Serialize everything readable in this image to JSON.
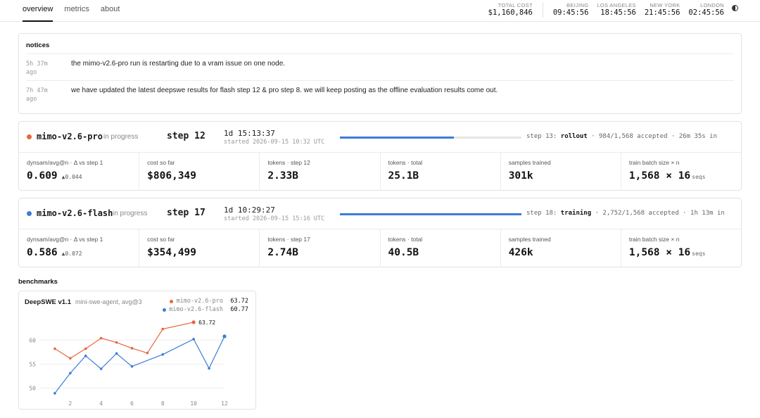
{
  "nav": {
    "tabs": [
      {
        "label": "overview",
        "active": true
      },
      {
        "label": "metrics",
        "active": false
      },
      {
        "label": "about",
        "active": false
      }
    ]
  },
  "header_stats": {
    "total_cost": {
      "label": "TOTAL COST",
      "value": "$1,160,846"
    },
    "clocks": [
      {
        "label": "BEIJING",
        "time": "09:45:56"
      },
      {
        "label": "LOS ANGELES",
        "time": "18:45:56"
      },
      {
        "label": "NEW YORK",
        "time": "21:45:56"
      },
      {
        "label": "LONDON",
        "time": "02:45:56"
      }
    ],
    "theme_icon": "half-circle-icon"
  },
  "notices": {
    "title": "notices",
    "items": [
      {
        "ago": "5h 37m ago",
        "message": "the mimo-v2.6-pro run is restarting due to a vram issue on one node."
      },
      {
        "ago": "7h 47m ago",
        "message": "we have updated the latest deepswe results for flash step 12 & pro step 8. we will keep posting as the offline evaluation results come out."
      }
    ]
  },
  "runs": [
    {
      "name": "mimo-v2.6-pro",
      "color": "#e8663d",
      "status": "in progress",
      "step": "step 12",
      "elapsed": "1d 15:13:37",
      "started": "started 2026-09-15 10:32 UTC",
      "progress": 0.628,
      "next_prefix": "step 13:",
      "next_phase": "rollout",
      "next_suffix": "· 984/1,568 accepted · 26m 35s in",
      "metrics": [
        {
          "label": "dynsam/avg@n · Δ vs step 1",
          "value": "0.609",
          "delta": "▲0.044",
          "unit": ""
        },
        {
          "label": "cost so far",
          "value": "$806,349",
          "delta": "",
          "unit": ""
        },
        {
          "label": "tokens · step 12",
          "value": "2.33B",
          "delta": "",
          "unit": ""
        },
        {
          "label": "tokens · total",
          "value": "25.1B",
          "delta": "",
          "unit": ""
        },
        {
          "label": "samples trained",
          "value": "301k",
          "delta": "",
          "unit": ""
        },
        {
          "label": "train batch size × n",
          "value": "1,568 × 16",
          "delta": "",
          "unit": "seqs"
        }
      ]
    },
    {
      "name": "mimo-v2.6-flash",
      "color": "#3b7dd8",
      "status": "in progress",
      "step": "step 17",
      "elapsed": "1d 10:29:27",
      "started": "started 2026-09-15 15:16 UTC",
      "progress": 1.0,
      "next_prefix": "step 18:",
      "next_phase": "training",
      "next_suffix": "· 2,752/1,568 accepted · 1h 13m in",
      "metrics": [
        {
          "label": "dynsam/avg@n · Δ vs step 1",
          "value": "0.586",
          "delta": "▲0.072",
          "unit": ""
        },
        {
          "label": "cost so far",
          "value": "$354,499",
          "delta": "",
          "unit": ""
        },
        {
          "label": "tokens · step 17",
          "value": "2.74B",
          "delta": "",
          "unit": ""
        },
        {
          "label": "tokens · total",
          "value": "40.5B",
          "delta": "",
          "unit": ""
        },
        {
          "label": "samples trained",
          "value": "426k",
          "delta": "",
          "unit": ""
        },
        {
          "label": "train batch size × n",
          "value": "1,568 × 16",
          "delta": "",
          "unit": "seqs"
        }
      ]
    }
  ],
  "benchmarks": {
    "title": "benchmarks",
    "chart_data": {
      "type": "line",
      "title": "DeepSWE v1.1",
      "subtitle": "mini-swe-agent, avg@3",
      "xlabel": "",
      "ylabel": "",
      "xlim": [
        0,
        12
      ],
      "ylim": [
        48,
        64
      ],
      "xticks": [
        2,
        4,
        6,
        8,
        10,
        12
      ],
      "yticks": [
        50,
        55,
        60
      ],
      "grid": true,
      "legend_position": "top-right",
      "series": [
        {
          "name": "mimo-v2.6-pro",
          "color": "#e8663d",
          "latest": "63.72",
          "x": [
            1,
            2,
            3,
            4,
            5,
            6,
            7,
            8,
            10
          ],
          "y": [
            58.2,
            56.2,
            58.2,
            60.4,
            59.5,
            58.3,
            57.3,
            62.3,
            63.72
          ]
        },
        {
          "name": "mimo-v2.6-flash",
          "color": "#3b7dd8",
          "latest": "60.77",
          "x": [
            1,
            2,
            3,
            4,
            5,
            6,
            8,
            10,
            11,
            12
          ],
          "y": [
            48.9,
            53.1,
            56.7,
            54.0,
            57.2,
            54.5,
            57.0,
            60.2,
            54.1,
            60.77
          ]
        }
      ],
      "annotations": [
        {
          "series": "mimo-v2.6-pro",
          "text": "63.72"
        }
      ]
    }
  }
}
